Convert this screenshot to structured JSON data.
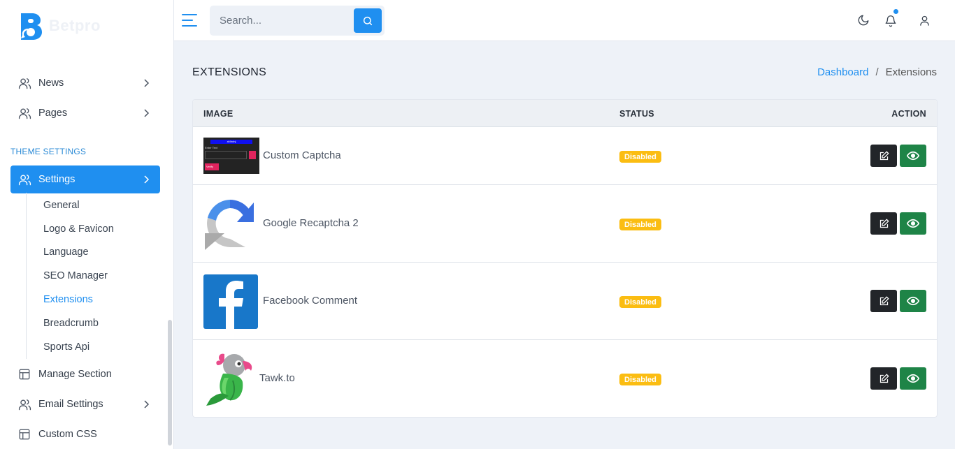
{
  "brand": {
    "name": "Betpro"
  },
  "sidebar": {
    "items_top": [
      {
        "label": "News"
      },
      {
        "label": "Pages"
      }
    ],
    "section_title": "THEME SETTINGS",
    "settings": {
      "label": "Settings"
    },
    "sub_items": [
      {
        "label": "General"
      },
      {
        "label": "Logo & Favicon"
      },
      {
        "label": "Language"
      },
      {
        "label": "SEO Manager"
      },
      {
        "label": "Extensions"
      },
      {
        "label": "Breadcrumb"
      },
      {
        "label": "Sports Api"
      }
    ],
    "items_bottom": [
      {
        "label": "Manage Section"
      },
      {
        "label": "Email Settings"
      },
      {
        "label": "Custom CSS"
      }
    ]
  },
  "header": {
    "search_placeholder": "Search..."
  },
  "page": {
    "title": "EXTENSIONS",
    "breadcrumb": {
      "home": "Dashboard",
      "separator": "/",
      "current": "Extensions"
    }
  },
  "table": {
    "columns": {
      "image": "IMAGE",
      "status": "STATUS",
      "action": "ACTION"
    },
    "rows": [
      {
        "name": "Custom Captcha",
        "status": "Disabled"
      },
      {
        "name": "Google Recaptcha 2",
        "status": "Disabled"
      },
      {
        "name": "Facebook Comment",
        "status": "Disabled"
      },
      {
        "name": "Tawk.to",
        "status": "Disabled"
      }
    ],
    "captcha_thumb": {
      "header": "aNbdnj",
      "label": "Enter Text",
      "button": "Verify"
    }
  },
  "colors": {
    "accent": "#1f8ff0",
    "badge_warning": "#fbbd12",
    "btn_dark": "#222529",
    "btn_success": "#1e8447"
  },
  "icons": {
    "edit": "edit-icon",
    "view": "eye-icon",
    "theme": "moon-icon",
    "notifications": "bell-icon",
    "user": "user-icon"
  }
}
